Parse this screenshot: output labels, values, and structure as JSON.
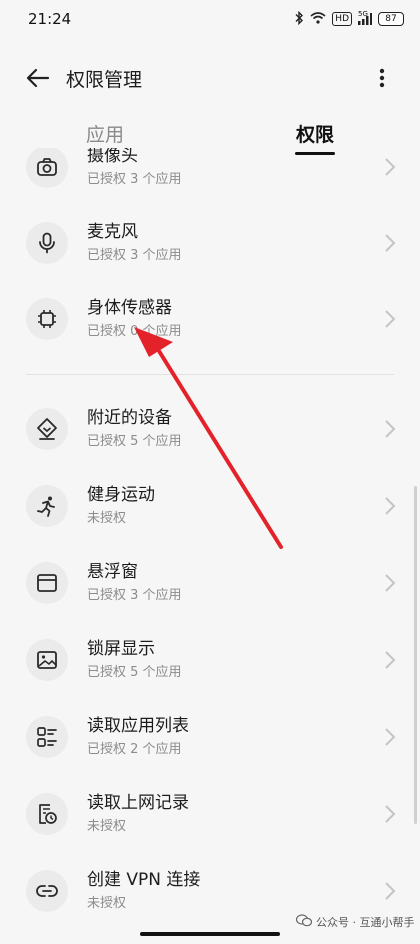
{
  "status_bar": {
    "time": "21:24",
    "network_badge": "HD",
    "signal_label": "5G",
    "battery": "87"
  },
  "header": {
    "title": "权限管理"
  },
  "tabs": [
    {
      "label": "应用",
      "active": false
    },
    {
      "label": "权限",
      "active": true
    }
  ],
  "permissions": [
    {
      "title": "摄像头",
      "subtitle": "已授权 3 个应用",
      "icon": "camera-icon"
    },
    {
      "title": "麦克风",
      "subtitle": "已授权 3 个应用",
      "icon": "microphone-icon"
    },
    {
      "title": "身体传感器",
      "subtitle": "已授权 0 个应用",
      "icon": "chip-icon"
    },
    {
      "title": "附近的设备",
      "subtitle": "已授权 5 个应用",
      "icon": "nearby-devices-icon"
    },
    {
      "title": "健身运动",
      "subtitle": "未授权",
      "icon": "running-icon"
    },
    {
      "title": "悬浮窗",
      "subtitle": "已授权 3 个应用",
      "icon": "window-icon"
    },
    {
      "title": "锁屏显示",
      "subtitle": "已授权 5 个应用",
      "icon": "image-icon"
    },
    {
      "title": "读取应用列表",
      "subtitle": "已授权 2 个应用",
      "icon": "app-list-icon"
    },
    {
      "title": "读取上网记录",
      "subtitle": "未授权",
      "icon": "history-icon"
    },
    {
      "title": "创建 VPN 连接",
      "subtitle": "未授权",
      "icon": "link-icon"
    }
  ],
  "watermark": "公众号 · 互通小帮手",
  "colors": {
    "annotation_arrow": "#e4222a",
    "background": "#f6f6f6",
    "icon_bg": "#ebebeb"
  }
}
